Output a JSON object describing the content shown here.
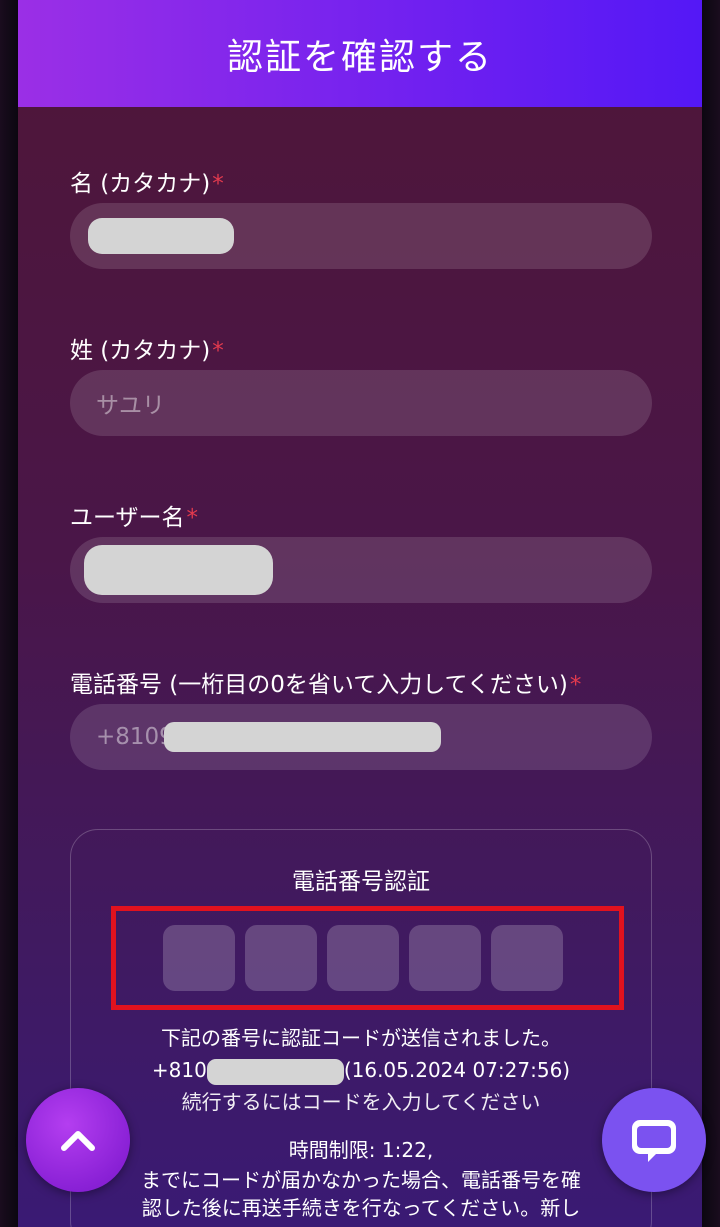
{
  "modal": {
    "title": "認証を確認する"
  },
  "fields": {
    "first_name": {
      "label": "名 (カタカナ)",
      "required_mark": "*",
      "value": ""
    },
    "last_name": {
      "label": "姓 (カタカナ)",
      "required_mark": "*",
      "placeholder": "サユリ"
    },
    "username": {
      "label": "ユーザー名",
      "required_mark": "*",
      "value": ""
    },
    "phone": {
      "label": "電話番号 (一桁目の0を省いて入力してください)",
      "required_mark": "*",
      "value_prefix": "+8109"
    }
  },
  "verification": {
    "title": "電話番号認証",
    "code_cells": [
      "",
      "",
      "",
      "",
      ""
    ],
    "sent_message": "下記の番号に認証コードが送信されました。",
    "phone_prefix": "+810",
    "sent_timestamp": "(16.05.2024 07:27:56)",
    "continue_message": "続行するにはコードを入力してください",
    "time_limit_label": "時間制限:",
    "time_limit_value": "1:22,",
    "resend_message_line1": "までにコードが届かなかった場合、電話番号を確",
    "resend_message_line2": "認した後に再送手続きを行なってください。新し"
  },
  "buttons": {
    "scroll_top_icon": "chevron-up-icon",
    "chat_icon": "chat-bubble-icon"
  },
  "colors": {
    "header_gradient_start": "#9b2fe6",
    "header_gradient_end": "#5418f6",
    "required": "#e23a4e",
    "highlight": "#e2121e",
    "chat_button": "#7b52f0"
  }
}
